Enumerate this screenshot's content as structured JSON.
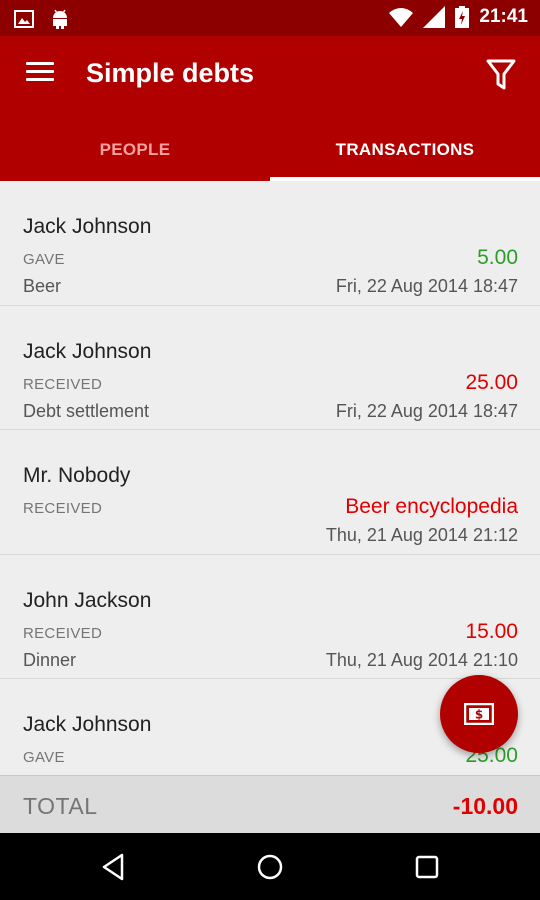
{
  "status_bar": {
    "time": "21:41",
    "left_icons": [
      "image-icon",
      "android-icon"
    ],
    "right_icons": [
      "wifi-icon",
      "signal-icon",
      "battery-icon"
    ]
  },
  "app_bar": {
    "title": "Simple debts",
    "menu_icon": "menu-icon",
    "filter_icon": "filter-icon",
    "color": "#b10000"
  },
  "tabs": [
    {
      "label": "PEOPLE",
      "active": false
    },
    {
      "label": "TRANSACTIONS",
      "active": true
    }
  ],
  "transactions": [
    {
      "name": "Jack Johnson",
      "type": "GAVE",
      "note": "Beer",
      "amount": "5.00",
      "date": "Fri, 22 Aug 2014 18:47"
    },
    {
      "name": "Jack Johnson",
      "type": "RECEIVED",
      "note": "Debt settlement",
      "amount": "25.00",
      "date": "Fri, 22 Aug 2014 18:47"
    },
    {
      "name": "Mr. Nobody",
      "type": "RECEIVED",
      "note": "",
      "amount": "Beer encyclopedia",
      "date": "Thu, 21 Aug 2014 21:12"
    },
    {
      "name": "John Jackson",
      "type": "RECEIVED",
      "note": "Dinner",
      "amount": "15.00",
      "date": "Thu, 21 Aug 2014 21:10"
    },
    {
      "name": "Jack Johnson",
      "type": "GAVE",
      "note": "",
      "amount": "25.00",
      "date": ""
    }
  ],
  "colors": {
    "gave": "#2a9d2a",
    "received": "#e00000"
  },
  "fab": {
    "icon": "money-icon"
  },
  "total": {
    "label": "TOTAL",
    "value": "-10.00"
  },
  "nav_bar": {
    "icons": [
      "back-icon",
      "home-icon",
      "recents-icon"
    ]
  }
}
